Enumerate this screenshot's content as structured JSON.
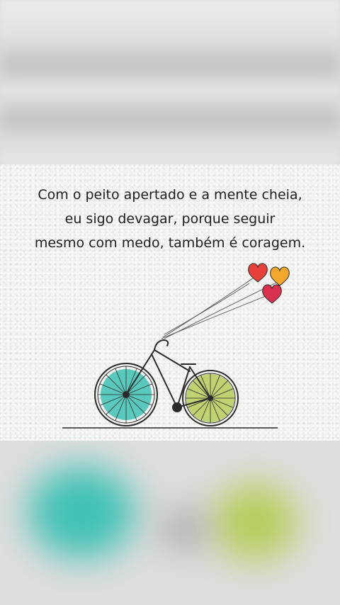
{
  "quote": {
    "lines": [
      "Com o peito apertado e a mente cheia,",
      "eu sigo devagar, porque seguir",
      "mesmo com medo, também é coragem."
    ]
  },
  "illustration": {
    "subject": "bicycle-with-heart-balloons",
    "colors": {
      "front_wheel": "#3fc1b4",
      "rear_wheel": "#b5cd5a",
      "balloon_red": "#e8413c",
      "balloon_orange": "#f2a72c",
      "balloon_pink": "#d9304f",
      "ink": "#2a2a2a",
      "paper": "#f2f2f0"
    }
  }
}
